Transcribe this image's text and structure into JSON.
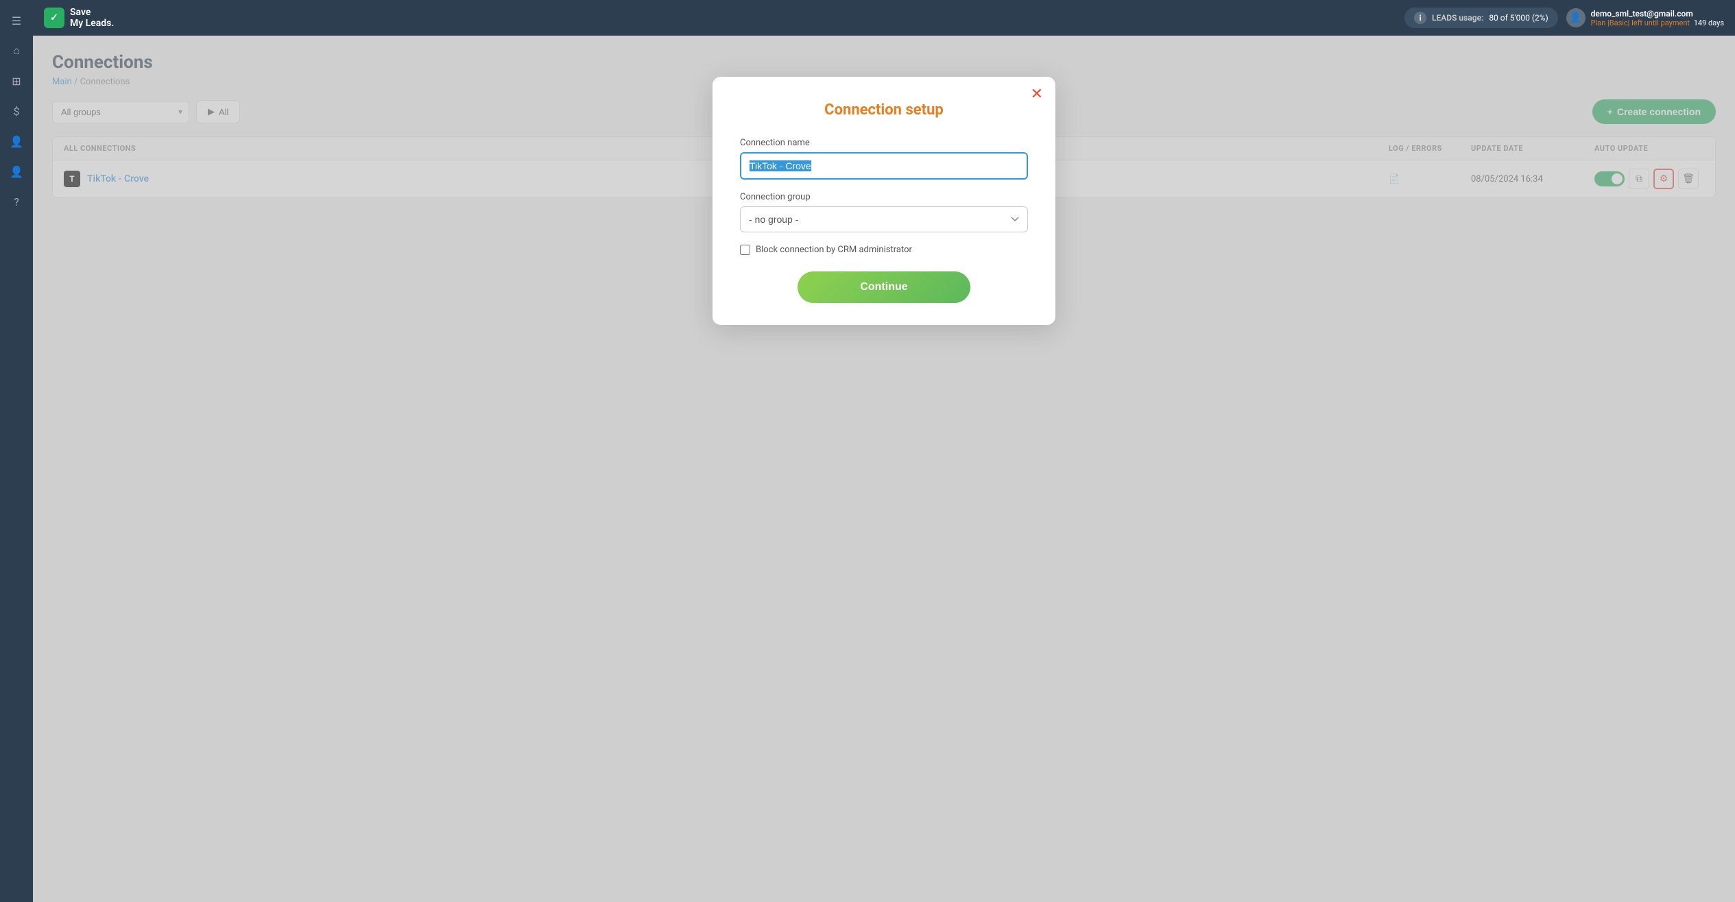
{
  "app": {
    "logo_text": "Save\nMy Leads.",
    "hamburger_label": "☰"
  },
  "topbar": {
    "leads_label": "LEADS usage:",
    "leads_count": "80 of 5'000 (2%)",
    "user_email": "demo_sml_test@gmail.com",
    "user_plan": "Plan |Basic| left until payment",
    "user_days": "149 days"
  },
  "page": {
    "title": "Connections",
    "breadcrumb_main": "Main",
    "breadcrumb_separator": " / ",
    "breadcrumb_current": "Connections"
  },
  "toolbar": {
    "group_filter_placeholder": "All groups",
    "status_filter_label": "All",
    "create_btn_label": "Create connection",
    "create_btn_icon": "+"
  },
  "table": {
    "headers": {
      "all_connections": "ALL CONNECTIONS",
      "log_errors": "LOG / ERRORS",
      "update_date": "UPDATE DATE",
      "auto_update": "AUTO UPDATE"
    },
    "rows": [
      {
        "name": "TikTok - Crove",
        "icon": "T",
        "log_icon": "📄",
        "update_date": "08/05/2024 16:34",
        "auto_update": true
      }
    ]
  },
  "modal": {
    "title": "Connection setup",
    "close_icon": "✕",
    "connection_name_label": "Connection name",
    "connection_name_value": "TikTok - Crove",
    "connection_group_label": "Connection group",
    "connection_group_default": "- no group -",
    "connection_group_options": [
      "- no group -"
    ],
    "block_label": "Block connection by CRM administrator",
    "continue_label": "Continue"
  },
  "sidebar": {
    "items": [
      {
        "icon": "☰",
        "name": "hamburger-icon"
      },
      {
        "icon": "⌂",
        "name": "home-icon"
      },
      {
        "icon": "⊞",
        "name": "grid-icon"
      },
      {
        "icon": "$",
        "name": "dollar-icon"
      },
      {
        "icon": "👤",
        "name": "user-icon"
      },
      {
        "icon": "👤",
        "name": "profile-icon"
      },
      {
        "icon": "?",
        "name": "help-icon"
      }
    ]
  }
}
